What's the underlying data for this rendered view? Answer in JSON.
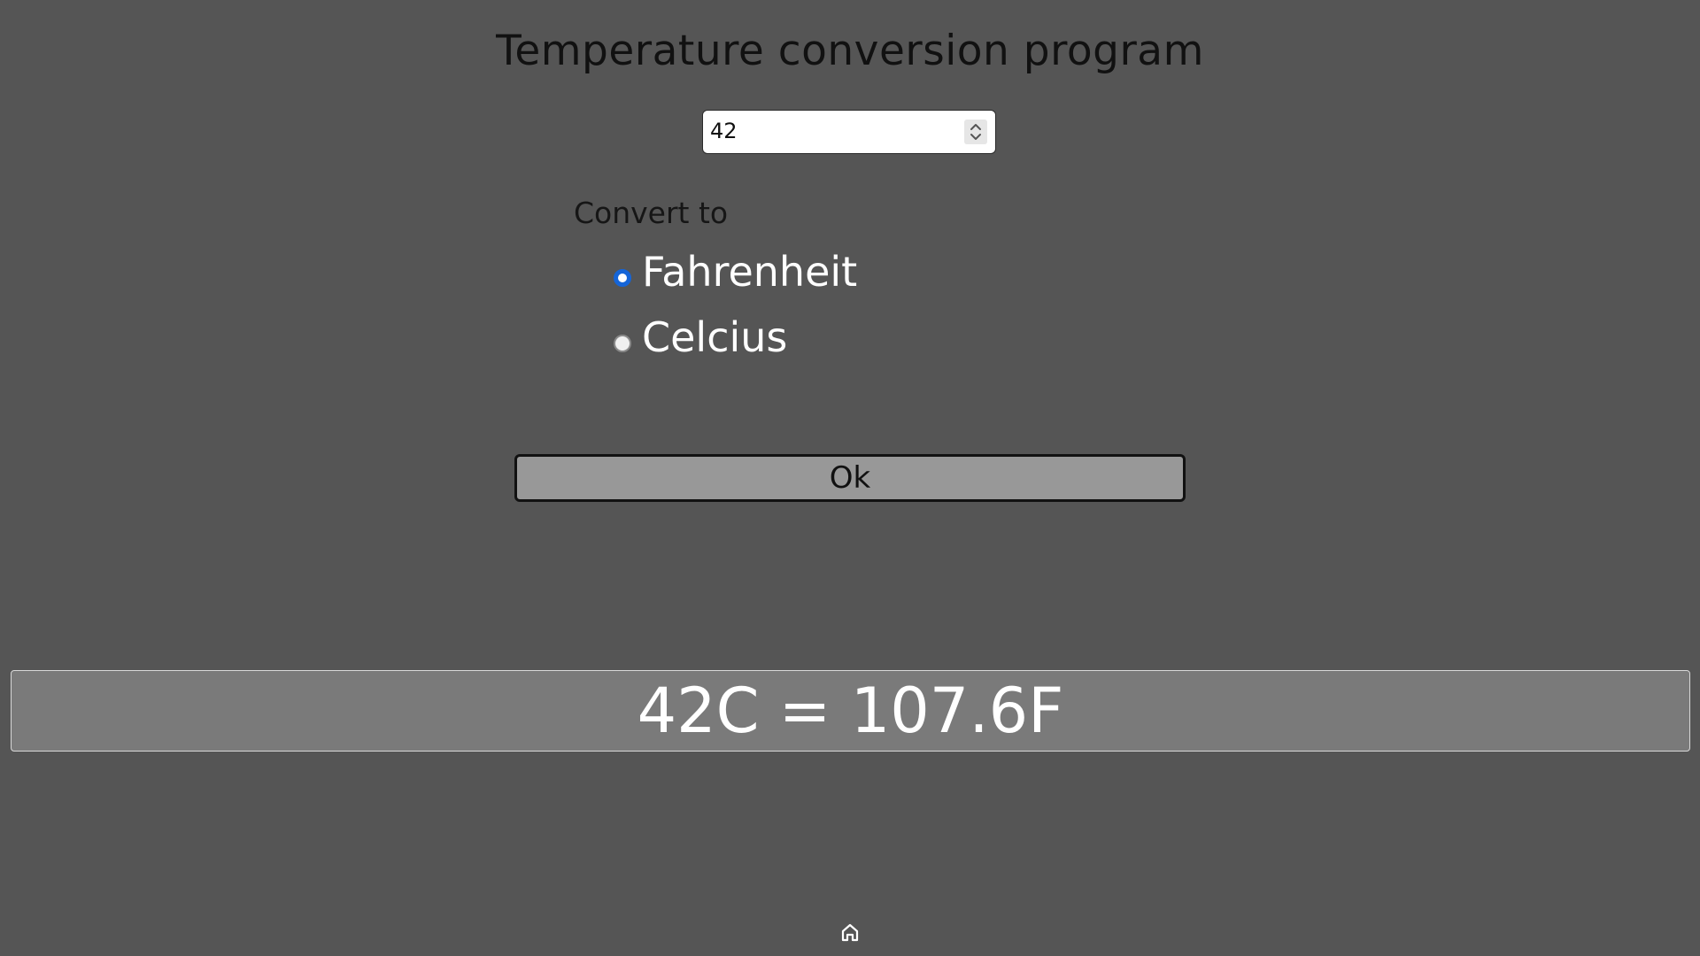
{
  "title": "Temperature conversion program",
  "input": {
    "value": "42",
    "spinner_icon": "spinner-up-down-icon"
  },
  "convert_label": "Convert to",
  "options": [
    {
      "label": "Fahrenheit",
      "checked": true
    },
    {
      "label": "Celcius",
      "checked": false
    }
  ],
  "ok_button_label": "Ok",
  "result": "42C = 107.6F",
  "footer": {
    "home_icon": "home-icon"
  },
  "colors": {
    "background": "#555555",
    "radio_accent": "#1565d8",
    "button_bg": "#989898",
    "result_bg": "#7a7a7a"
  }
}
